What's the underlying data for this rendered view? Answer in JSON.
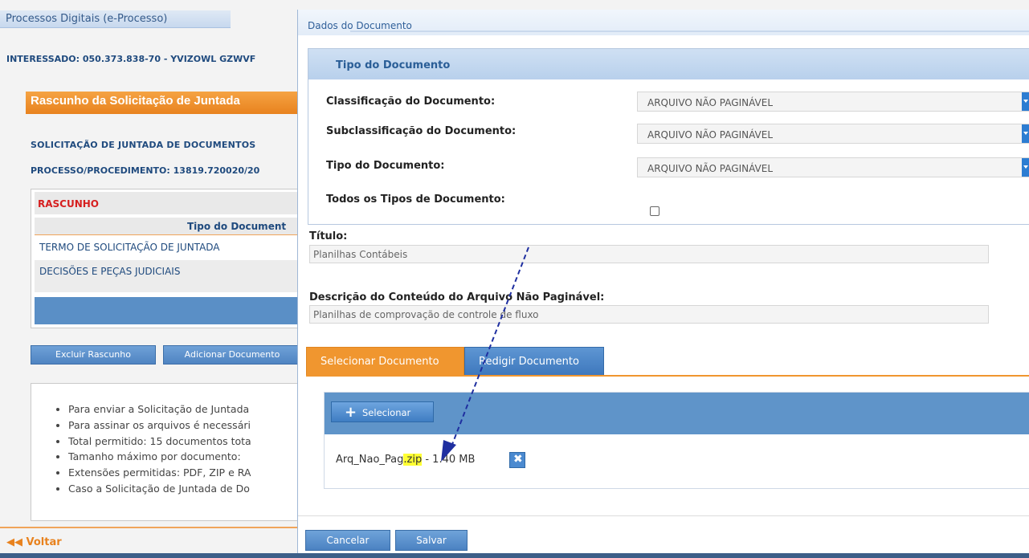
{
  "background": {
    "header_title": "Processos Digitais (e-Processo)",
    "interessado": "INTERESSADO: 050.373.838-70 - YVIZOWL GZWVF",
    "page_title": "Rascunho da Solicitação de Juntada",
    "solicitacao": "SOLICITAÇÃO DE JUNTADA DE DOCUMENTOS",
    "processo": "PROCESSO/PROCEDIMENTO: 13819.720020/20",
    "status": "RASCUNHO",
    "column_header": "Tipo do Document",
    "rows": [
      "TERMO DE SOLICITAÇÃO DE JUNTADA",
      "DECISÕES E PEÇAS JUDICIAIS"
    ],
    "buttons": {
      "delete_draft": "Excluir Rascunho",
      "add_document": "Adicionar Documento"
    },
    "info_items": [
      "Para enviar a Solicitação de Juntada",
      "Para assinar os arquivos é necessári",
      "Total permitido: 15 documentos tota",
      "Tamanho máximo por documento: ",
      "Extensões permitidas: PDF, ZIP e RA",
      "Caso a Solicitação de Juntada de Do"
    ],
    "back_label": "◀◀ Voltar"
  },
  "modal": {
    "title": "Dados do Documento",
    "tipo_section_title": "Tipo do Documento",
    "fields": {
      "classificacao_label": "Classificação do Documento:",
      "classificacao_value": "ARQUIVO NÃO PAGINÁVEL",
      "subclassificacao_label": "Subclassificação do Documento:",
      "subclassificacao_value": "ARQUIVO NÃO PAGINÁVEL",
      "tipo_label": "Tipo do Documento:",
      "tipo_value": "ARQUIVO NÃO PAGINÁVEL",
      "todos_label": "Todos os Tipos de Documento:"
    },
    "titulo_label": "Título:",
    "titulo_value": "Planilhas Contábeis",
    "descricao_label": "Descrição do Conteúdo do Arquivo Não Paginável:",
    "descricao_value": "Planilhas de comprovação de controle de fluxo",
    "tabs": {
      "selecionar": "Selecionar Documento",
      "redigir": "Redigir Documento"
    },
    "upload": {
      "select_button": "Selecionar",
      "file_name": "Arq_Nao_Pag",
      "file_ext": ".zip",
      "file_size": " - 1.40 MB"
    },
    "buttons": {
      "cancel": "Cancelar",
      "save": "Salvar"
    }
  },
  "colors": {
    "accent_orange": "#f0962f",
    "accent_blue": "#5f94c9",
    "highlight": "#ffff33",
    "arrow": "#1f2fa0"
  },
  "icons": [
    "plus-icon",
    "close-icon",
    "chevron-down-icon",
    "double-left-arrow-icon"
  ]
}
